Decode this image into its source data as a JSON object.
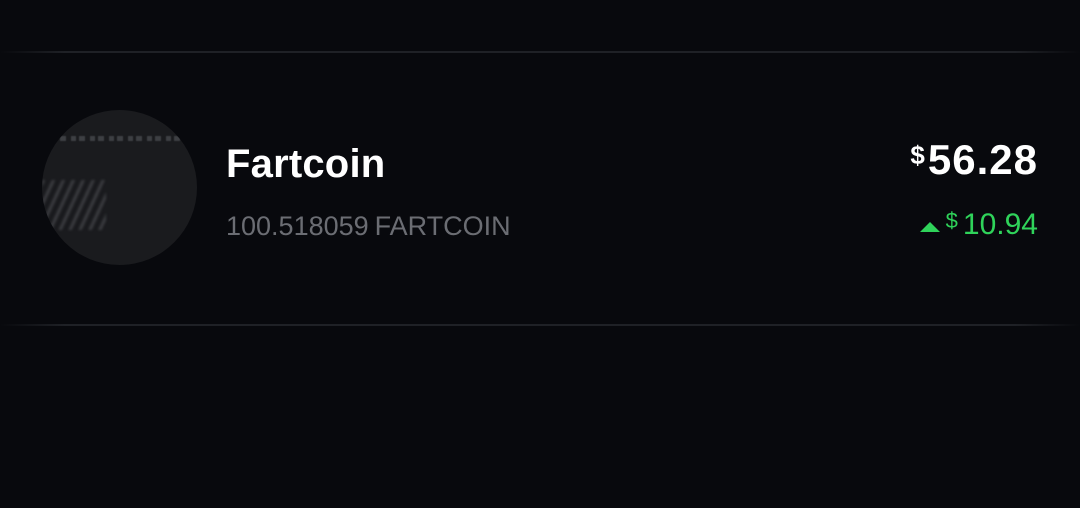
{
  "asset": {
    "name": "Fartcoin",
    "amount": "100.518059",
    "unit": "FARTCOIN",
    "value_symbol": "$",
    "value": "56.28",
    "change_symbol": "$",
    "change": "10.94",
    "change_direction_icon": "triangle-up-icon",
    "colors": {
      "background": "#08090d",
      "positive": "#2fd35a",
      "secondary_text": "#6b6d73"
    }
  }
}
